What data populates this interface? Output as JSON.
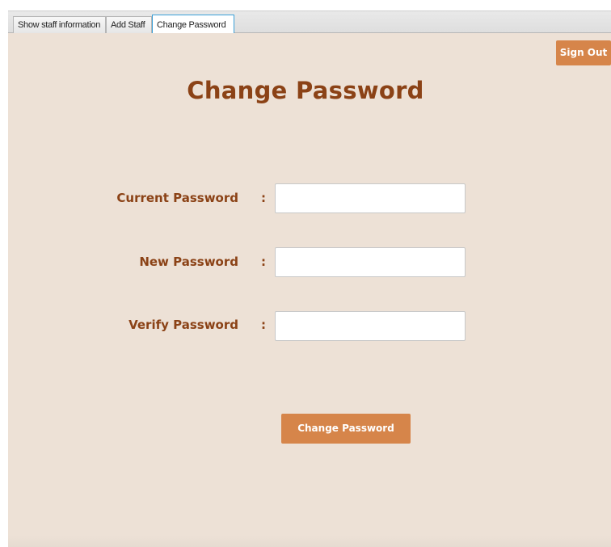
{
  "tabs": [
    {
      "label": "Show staff information",
      "active": false
    },
    {
      "label": "Add  Staff",
      "active": false
    },
    {
      "label": "Change Password",
      "active": true
    }
  ],
  "header": {
    "sign_out_label": "Sign Out"
  },
  "form": {
    "title": "Change Password",
    "separator": ":",
    "fields": [
      {
        "label": "Current Password",
        "value": "",
        "placeholder": ""
      },
      {
        "label": "New Password",
        "value": "",
        "placeholder": ""
      },
      {
        "label": "Verify Password",
        "value": "",
        "placeholder": ""
      }
    ],
    "submit_label": "Change Password"
  },
  "colors": {
    "panel_background": "#ede1d6",
    "accent_button": "#d6854a",
    "label_text": "#8b4216",
    "active_tab_border": "#3aa0d8"
  }
}
